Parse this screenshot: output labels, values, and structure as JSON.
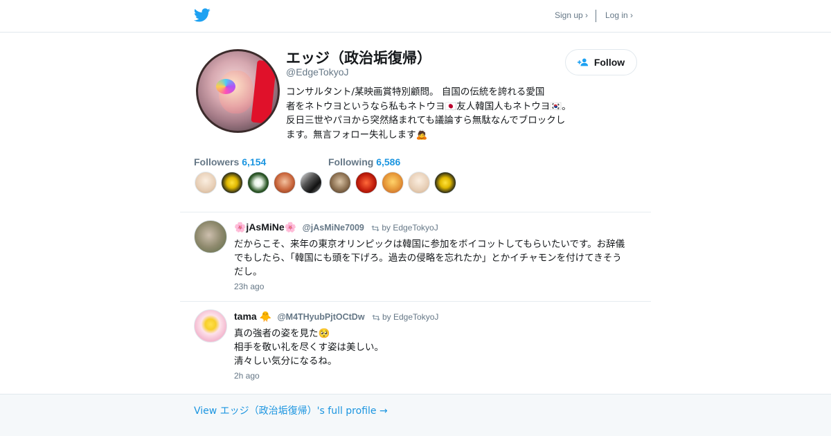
{
  "header": {
    "signup_label": "Sign up ›",
    "login_label": "Log in ›",
    "brand_color": "#1da1f2"
  },
  "profile": {
    "name": "エッジ（政治垢復帰）",
    "handle": "@EdgeTokyoJ",
    "follow_label": "Follow",
    "bio_lines": [
      "コンサルタント/某映画賞特別顧問。 自国の伝統を誇れる愛国",
      "者をネトウヨというなら私もネトウヨ🇯🇵友人韓国人もネトウヨ🇰🇷。",
      "反日三世やパヨから突然絡まれても議論すら無駄なんでブロックし",
      "ます。無言フォロー失礼します🙇"
    ]
  },
  "stats": {
    "followers_label": "Followers",
    "followers_count": "6,154",
    "following_label": "Following",
    "following_count": "6,586"
  },
  "tweets": [
    {
      "user_name": "🌸jAsMiNe🌸",
      "user_handle": "@jAsMiNe7009",
      "retweet_by": "by EdgeTokyoJ",
      "body_lines": [
        "だからこそ、来年の東京オリンピックは韓国に参加をボイコットしてもらいたいです。お辞儀",
        "でもしたら、「韓国にも頭を下げろ。過去の侵略を忘れたか」とかイチャモンを付けてきそう",
        "だし。"
      ],
      "time": "23h ago"
    },
    {
      "user_name": "tama 🐥",
      "user_handle": "@M4THyubPjtOCtDw",
      "retweet_by": "by EdgeTokyoJ",
      "body_lines": [
        "真の強者の姿を見た🥺",
        "相手を敬い礼を尽くす姿は美しい。",
        "清々しい気分になるね。"
      ],
      "time": "2h ago"
    }
  ],
  "footer": {
    "full_profile_label": "View エッジ（政治垢復帰）'s full profile →"
  }
}
